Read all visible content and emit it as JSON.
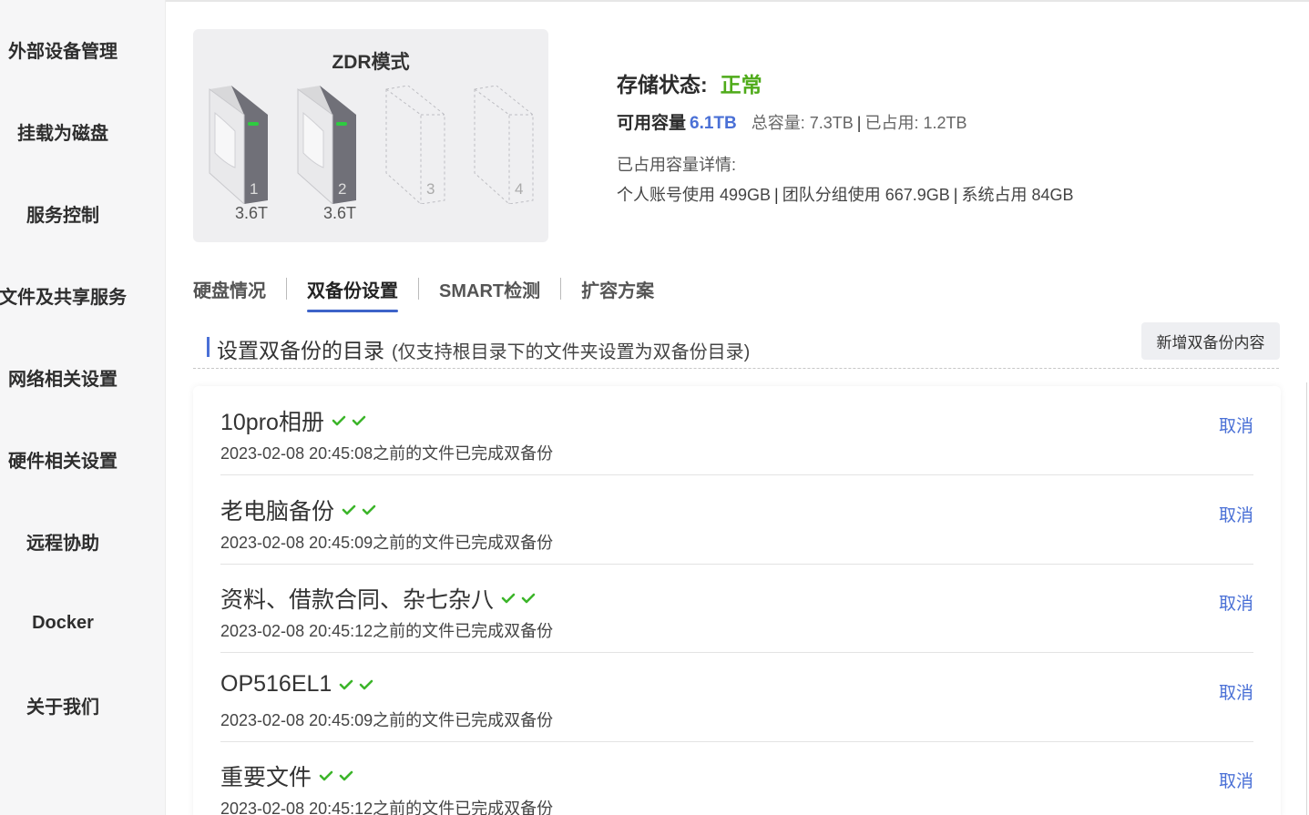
{
  "sidebar": {
    "items": [
      {
        "label": "外部设备管理"
      },
      {
        "label": "挂载为磁盘"
      },
      {
        "label": "服务控制"
      },
      {
        "label": "文件及共享服务"
      },
      {
        "label": "网络相关设置"
      },
      {
        "label": "硬件相关设置"
      },
      {
        "label": "远程协助"
      },
      {
        "label": "Docker"
      },
      {
        "label": "关于我们"
      }
    ]
  },
  "disk_panel": {
    "mode_title": "ZDR模式",
    "disks": [
      {
        "slot": "1",
        "size": "3.6T",
        "installed": true
      },
      {
        "slot": "2",
        "size": "3.6T",
        "installed": true
      },
      {
        "slot": "3",
        "size": "",
        "installed": false
      },
      {
        "slot": "4",
        "size": "",
        "installed": false
      }
    ]
  },
  "storage": {
    "status_label": "存储状态:",
    "status_value": "正常",
    "available_label": "可用容量",
    "available_value": "6.1TB",
    "total": "总容量: 7.3TB",
    "used": "已占用: 1.2TB",
    "detail_title": "已占用容量详情:",
    "detail_personal": "个人账号使用 499GB",
    "detail_team": "团队分组使用 667.9GB",
    "detail_system": "系统占用 84GB"
  },
  "tabs": [
    {
      "label": "硬盘情况",
      "active": false
    },
    {
      "label": "双备份设置",
      "active": true
    },
    {
      "label": "SMART检测",
      "active": false
    },
    {
      "label": "扩容方案",
      "active": false
    }
  ],
  "section": {
    "title": "设置双备份的目录",
    "hint": "(仅支持根目录下的文件夹设置为双备份目录)",
    "add_button": "新增双备份内容"
  },
  "backups": [
    {
      "name": "10pro相册",
      "time": "2023-02-08 20:45:08之前的文件已完成双备份",
      "cancel": "取消"
    },
    {
      "name": "老电脑备份",
      "time": "2023-02-08 20:45:09之前的文件已完成双备份",
      "cancel": "取消"
    },
    {
      "name": "资料、借款合同、杂七杂八",
      "time": "2023-02-08 20:45:12之前的文件已完成双备份",
      "cancel": "取消"
    },
    {
      "name": "OP516EL1",
      "time": "2023-02-08 20:45:09之前的文件已完成双备份",
      "cancel": "取消"
    },
    {
      "name": "重要文件",
      "time": "2023-02-08 20:45:12之前的文件已完成双备份",
      "cancel": "取消"
    }
  ],
  "colors": {
    "accent": "#4a70d6",
    "status_ok": "#4fab1a",
    "check": "#3cb52a"
  }
}
